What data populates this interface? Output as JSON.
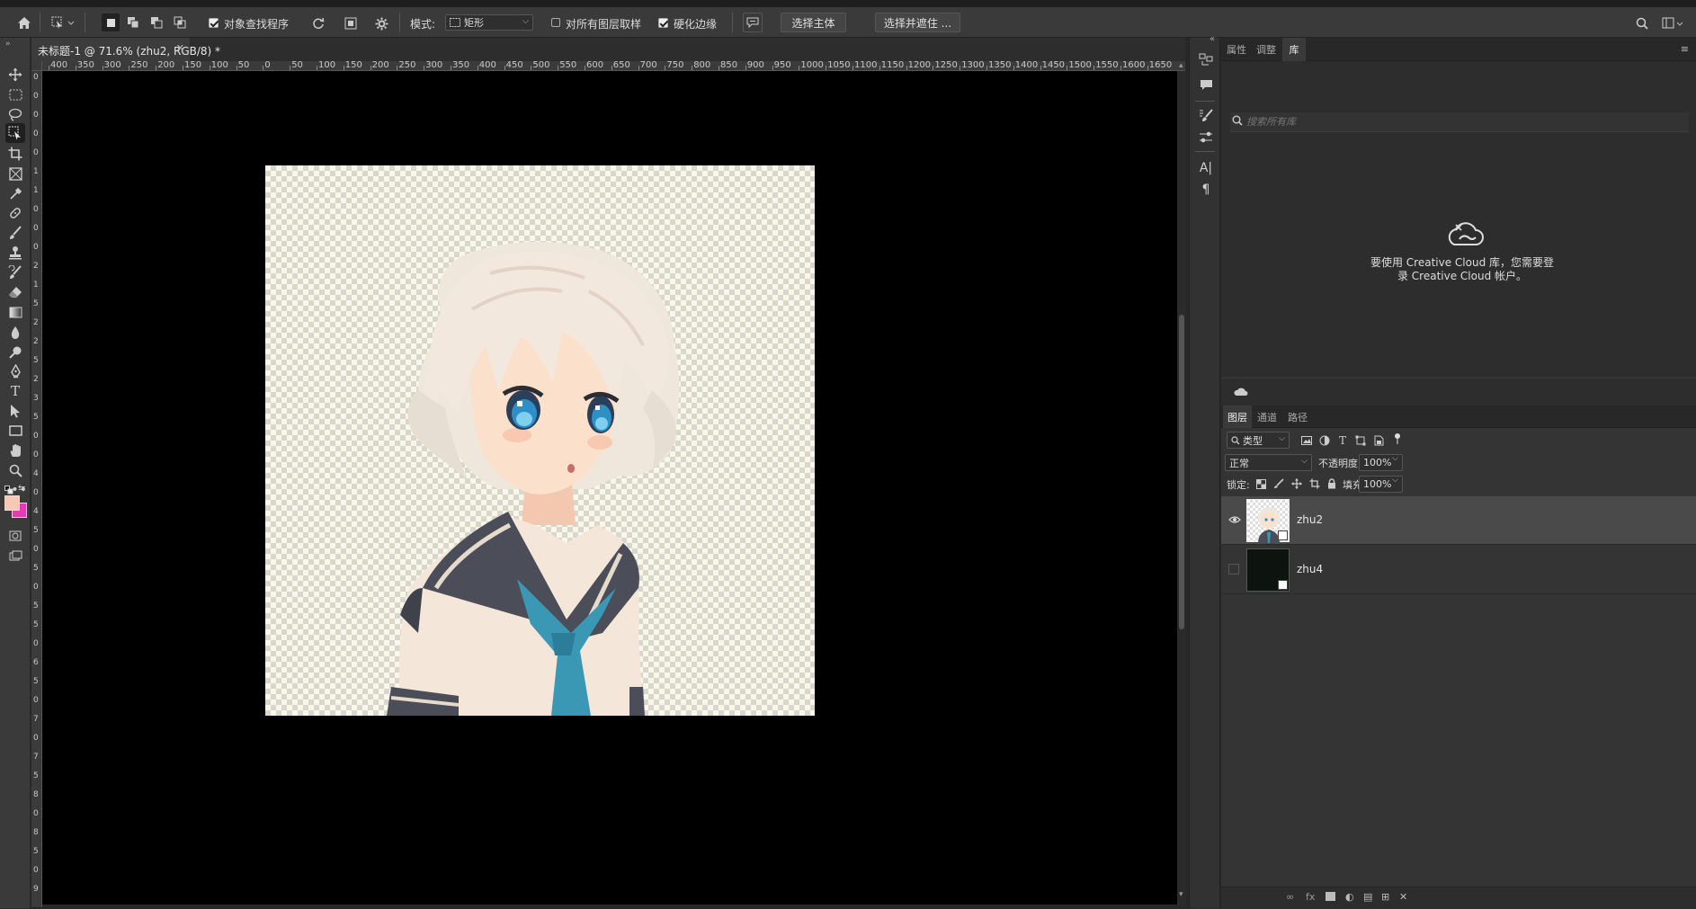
{
  "optionsBar": {
    "mode_label": "模式:",
    "mode_value": "矩形",
    "object_finder_label": "对象查找程序",
    "object_finder_checked": true,
    "sample_all_label": "对所有图层取样",
    "sample_all_checked": false,
    "hard_edge_label": "硬化边缘",
    "hard_edge_checked": true,
    "select_subject_button": "选择主体",
    "select_mask_button": "选择并遮住 ..."
  },
  "document": {
    "tab_title": "未标题-1 @ 71.6% (zhu2, RGB/8) *",
    "h_ruler_ticks": [
      "400",
      "350",
      "300",
      "250",
      "200",
      "150",
      "100",
      "50",
      "0",
      "50",
      "100",
      "150",
      "200",
      "250",
      "300",
      "350",
      "400",
      "450",
      "500",
      "550",
      "600",
      "650",
      "700",
      "750",
      "800",
      "850",
      "900",
      "950",
      "1000",
      "1050",
      "1100",
      "1150",
      "1200",
      "1250",
      "1300",
      "1350",
      "1400",
      "1450",
      "1500",
      "1550",
      "1600",
      "1650"
    ],
    "v_ruler_labels": [
      "0",
      "0",
      "0",
      "0",
      "0",
      "1",
      "1",
      "0",
      "0",
      "0",
      "2",
      "1",
      "5",
      "2",
      "2",
      "5",
      "2",
      "3",
      "5",
      "0",
      "0",
      "4",
      "0",
      "4",
      "5",
      "0",
      "5",
      "0",
      "5",
      "5",
      "0",
      "6",
      "5",
      "0",
      "7",
      "0",
      "7",
      "5",
      "8",
      "0",
      "8",
      "5",
      "0",
      "9"
    ]
  },
  "toolbox": {
    "foreground_color": "#f6c9b6",
    "background_color": "#e83bb2",
    "tools": [
      "move-tool",
      "marquee-tool",
      "lasso-tool",
      "object-selection-tool",
      "crop-tool",
      "frame-tool",
      "eyedropper-tool",
      "healing-brush-tool",
      "brush-tool",
      "clone-stamp-tool",
      "history-brush-tool",
      "eraser-tool",
      "gradient-tool",
      "blur-tool",
      "dodge-tool",
      "pen-tool",
      "type-tool",
      "path-selection-tool",
      "rectangle-tool",
      "hand-tool",
      "zoom-tool",
      "more-tools"
    ]
  },
  "libraries": {
    "tabs": [
      "属性",
      "调整",
      "库"
    ],
    "active_tab": "库",
    "search_placeholder": "搜索所有库",
    "cloud_message_line1": "要使用 Creative Cloud 库，您需要登",
    "cloud_message_line2": "录 Creative Cloud 帐户。"
  },
  "layers": {
    "tabs": [
      "图层",
      "通道",
      "路径"
    ],
    "active_tab": "图层",
    "filter_label": "类型",
    "blend_mode": "正常",
    "opacity_label": "不透明度:",
    "opacity_value": "100%",
    "lock_label": "锁定:",
    "fill_label": "填充:",
    "fill_value": "100%",
    "items": [
      {
        "name": "zhu2",
        "visible": true,
        "selected": true
      },
      {
        "name": "zhu4",
        "visible": false,
        "selected": false
      }
    ]
  }
}
